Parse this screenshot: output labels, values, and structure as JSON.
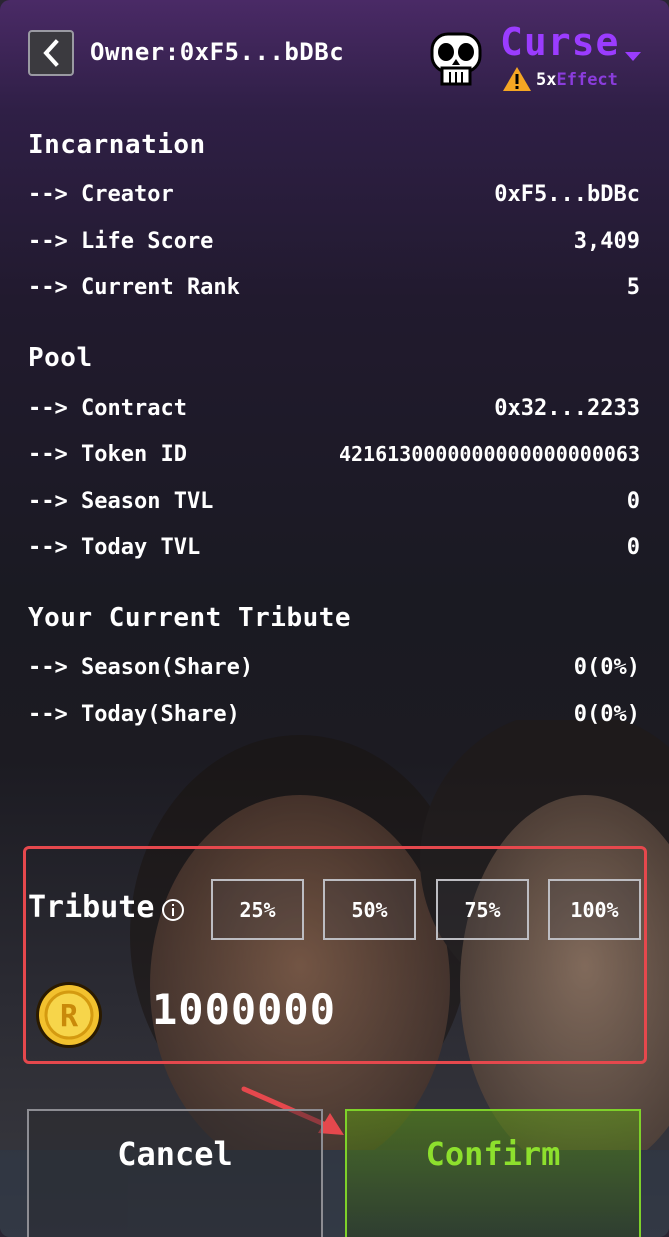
{
  "header": {
    "owner_label": "Owner:0xF5...bDBc",
    "curse_label": "Curse",
    "effect_multiplier": "5x",
    "effect_label": "Effect",
    "accent_color": "#9b3cff"
  },
  "incarnation": {
    "title": "Incarnation",
    "rows": [
      {
        "label": "--> Creator",
        "value": "0xF5...bDBc"
      },
      {
        "label": "--> Life Score",
        "value": "3,409"
      },
      {
        "label": "--> Current Rank",
        "value": "5"
      }
    ]
  },
  "pool": {
    "title": "Pool",
    "rows": [
      {
        "label": "--> Contract",
        "value": "0x32...2233"
      },
      {
        "label": "--> Token ID",
        "value": "4216130000000000000000063"
      },
      {
        "label": "--> Season TVL",
        "value": "0"
      },
      {
        "label": "--> Today TVL",
        "value": "0"
      }
    ]
  },
  "your_tribute": {
    "title": "Your Current Tribute",
    "rows": [
      {
        "label": "--> Season(Share)",
        "value": "0(0%)"
      },
      {
        "label": "--> Today(Share)",
        "value": "0(0%)"
      }
    ]
  },
  "tribute": {
    "label": "Tribute",
    "percent_buttons": [
      "25%",
      "50%",
      "75%",
      "100%"
    ],
    "coin_letter": "R",
    "amount": "1000000"
  },
  "actions": {
    "cancel_label": "Cancel",
    "confirm_label": "Confirm",
    "confirm_color": "#8de02d"
  }
}
